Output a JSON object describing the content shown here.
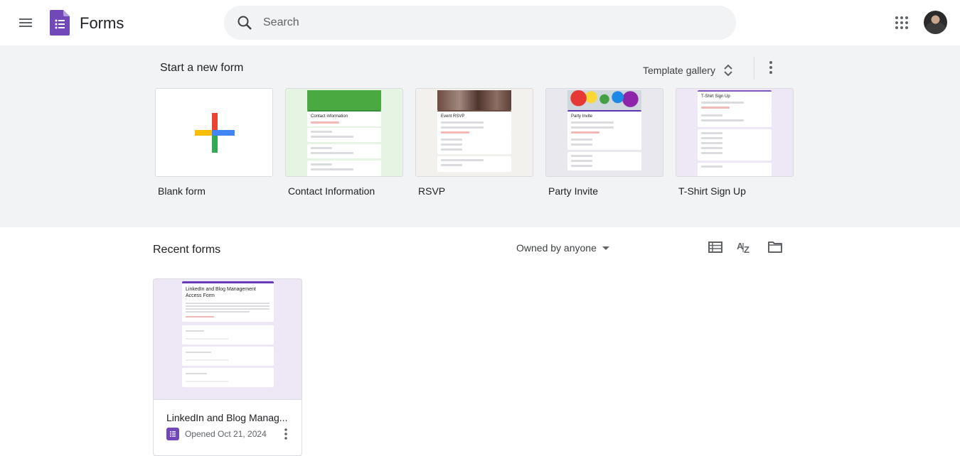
{
  "header": {
    "app_title": "Forms",
    "search_placeholder": "Search",
    "icons": [
      "menu-icon",
      "forms-logo-icon",
      "search-icon",
      "apps-grid-icon",
      "account-avatar"
    ]
  },
  "templates": {
    "section_title": "Start a new form",
    "gallery_label": "Template gallery",
    "items": [
      {
        "label": "Blank form"
      },
      {
        "label": "Contact Information",
        "preview_title": "Contact information"
      },
      {
        "label": "RSVP",
        "preview_title": "Event RSVP"
      },
      {
        "label": "Party Invite",
        "preview_title": "Party Invite"
      },
      {
        "label": "T-Shirt Sign Up",
        "preview_title": "T-Shirt Sign Up"
      }
    ]
  },
  "recent": {
    "section_title": "Recent forms",
    "owner_filter": "Owned by anyone",
    "documents": [
      {
        "title": "LinkedIn and Blog Manag...",
        "preview_title": "LinkedIn and Blog Management Access Form",
        "opened": "Opened Oct 21, 2024"
      }
    ]
  },
  "colors": {
    "brand_purple": "#7248b9",
    "band_bg": "#f1f3f4",
    "plus_red": "#ea4335",
    "plus_blue": "#4285f4",
    "plus_green": "#34a853",
    "plus_yellow": "#fbbc04"
  }
}
